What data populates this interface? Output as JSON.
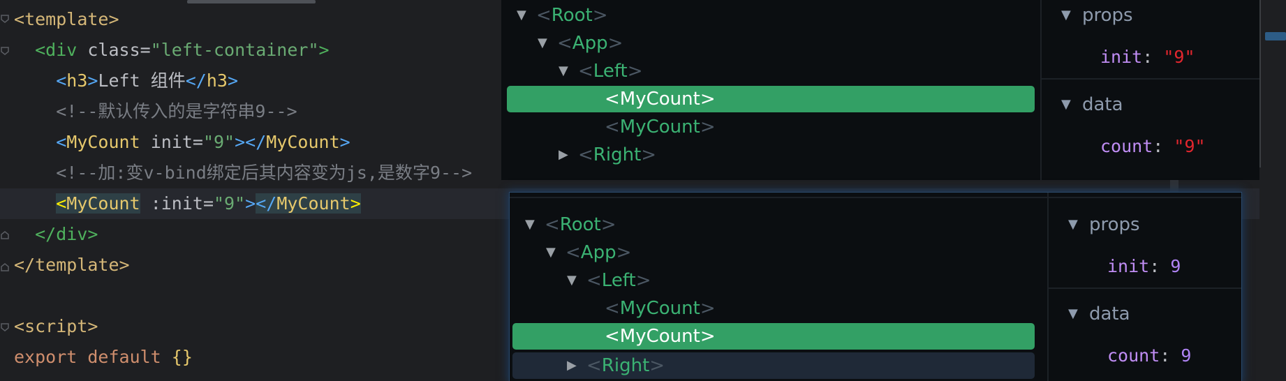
{
  "editor": {
    "lines": {
      "l1": {
        "open": "<",
        "tag": "template",
        "close": ">"
      },
      "l2": {
        "indent": "  ",
        "open": "<",
        "tag": "div",
        "attr": " class=",
        "value": "\"left-container\"",
        "close": ">"
      },
      "l3": {
        "indent": "    ",
        "open": "<",
        "tag": "h3",
        "close": ">",
        "text": "Left 组件",
        "end_open": "</",
        "end_tag": "h3",
        "end_close": ">"
      },
      "l4": {
        "indent": "    ",
        "comment": "<!--默认传入的是字符串9-->"
      },
      "l5": {
        "indent": "    ",
        "open": "<",
        "tag": "MyCount",
        "attr": " init=",
        "value": "\"9\"",
        "close": ">",
        "end_open": "</",
        "end_tag": "MyCount",
        "end_close": ">"
      },
      "l6": {
        "indent": "    ",
        "comment": "<!--加:变v-bind绑定后其内容变为js,是数字9-->"
      },
      "l7": {
        "indent": "    ",
        "open": "<",
        "tag": "MyCount",
        "attr": " :init=",
        "value": "\"9\"",
        "close": ">",
        "end_open": "</",
        "end_tag": "MyCount",
        "end_close": ">"
      },
      "l8": {
        "indent": "  ",
        "end_open": "</",
        "end_tag": "div",
        "end_close": ">"
      },
      "l9": {
        "end_open": "</",
        "end_tag": "template",
        "end_close": ">"
      },
      "l11": {
        "open": "<",
        "tag": "script",
        "close": ">"
      },
      "l12": {
        "keyword": "export default ",
        "brace": "{}"
      }
    }
  },
  "devtools_top": {
    "tree": [
      {
        "lt": "<",
        "name": "Root",
        "gt": ">",
        "arrow": "▼"
      },
      {
        "lt": "<",
        "name": "App",
        "gt": ">",
        "arrow": "▼"
      },
      {
        "lt": "<",
        "name": "Left",
        "gt": ">",
        "arrow": "▼"
      },
      {
        "lt": "<",
        "name": "MyCount",
        "gt": ">",
        "arrow": ""
      },
      {
        "lt": "<",
        "name": "MyCount",
        "gt": ">",
        "arrow": ""
      },
      {
        "lt": "<",
        "name": "Right",
        "gt": ">",
        "arrow": "▶"
      }
    ],
    "props_title": "props",
    "prop_key": "init",
    "prop_value": "\"9\"",
    "data_title": "data",
    "data_key": "count",
    "data_value": "\"9\""
  },
  "devtools_bottom": {
    "tree": [
      {
        "lt": "<",
        "name": "Root",
        "gt": ">",
        "arrow": "▼"
      },
      {
        "lt": "<",
        "name": "App",
        "gt": ">",
        "arrow": "▼"
      },
      {
        "lt": "<",
        "name": "Left",
        "gt": ">",
        "arrow": "▼"
      },
      {
        "lt": "<",
        "name": "MyCount",
        "gt": ">",
        "arrow": ""
      },
      {
        "lt": "<",
        "name": "MyCount",
        "gt": ">",
        "arrow": ""
      },
      {
        "lt": "<",
        "name": "Right",
        "gt": ">",
        "arrow": "▶"
      }
    ],
    "props_title": "props",
    "prop_key": "init",
    "prop_value": "9",
    "data_title": "data",
    "data_key": "count",
    "data_value": "9"
  },
  "colon": ":",
  "caret": "▼"
}
